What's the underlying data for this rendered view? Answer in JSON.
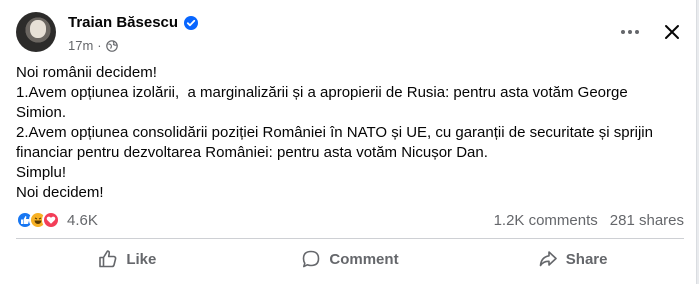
{
  "post": {
    "author": "Traian Băsescu",
    "time": "17m",
    "separator": "·",
    "lines": [
      "Noi românii decidem!",
      "1.Avem opțiunea izolării,  a marginalizării și a apropierii de Rusia: pentru asta votăm George",
      "Simion.",
      "2.Avem opțiunea consolidării poziției României în NATO și UE, cu garanții de securitate și sprijin",
      "financiar pentru dezvoltarea României: pentru asta votăm Nicușor Dan.",
      "Simplu!",
      "Noi decidem!"
    ]
  },
  "stats": {
    "reactions_count": "4.6K",
    "comments": "1.2K comments",
    "shares": "281 shares"
  },
  "action_bar": {
    "like": "Like",
    "comment": "Comment",
    "share": "Share"
  },
  "colors": {
    "verified": "#0866ff",
    "secondary_text": "#65676b",
    "like_reaction": "#1877f2",
    "haha_reaction": "#f7b125",
    "love_reaction": "#f33e58"
  },
  "icons": [
    "verified-badge-icon",
    "globe-icon",
    "more-icon",
    "close-icon",
    "like-reaction-icon",
    "haha-reaction-icon",
    "love-reaction-icon",
    "thumbs-up-icon",
    "comment-icon",
    "share-icon"
  ]
}
